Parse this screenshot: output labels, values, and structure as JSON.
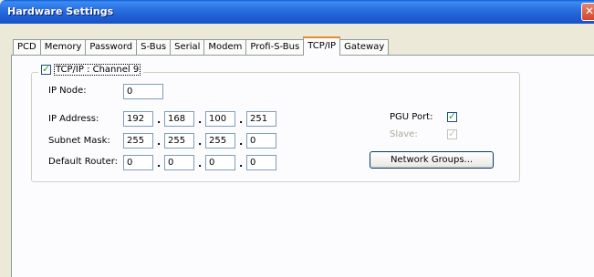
{
  "window": {
    "title": "Hardware Settings"
  },
  "tabs": [
    {
      "label": "PCD"
    },
    {
      "label": "Memory"
    },
    {
      "label": "Password"
    },
    {
      "label": "S-Bus"
    },
    {
      "label": "Serial"
    },
    {
      "label": "Modem"
    },
    {
      "label": "Profi-S-Bus"
    },
    {
      "label": "TCP/IP",
      "active": true
    },
    {
      "label": "Gateway"
    }
  ],
  "tcpip": {
    "group_label": "TCP/IP : Channel 9",
    "enabled": true,
    "ip_node_label": "IP Node:",
    "ip_node_value": "0",
    "ip_address_label": "IP Address:",
    "ip_address": [
      "192",
      "168",
      "100",
      "251"
    ],
    "subnet_mask_label": "Subnet Mask:",
    "subnet_mask": [
      "255",
      "255",
      "255",
      "0"
    ],
    "default_router_label": "Default Router:",
    "default_router": [
      "0",
      "0",
      "0",
      "0"
    ],
    "pgu_port_label": "PGU Port:",
    "pgu_port_checked": true,
    "slave_label": "Slave:",
    "slave_checked": true,
    "network_groups_button": "Network Groups..."
  },
  "icons": {
    "close": "close-icon",
    "checkbox": "checkbox-icon"
  }
}
